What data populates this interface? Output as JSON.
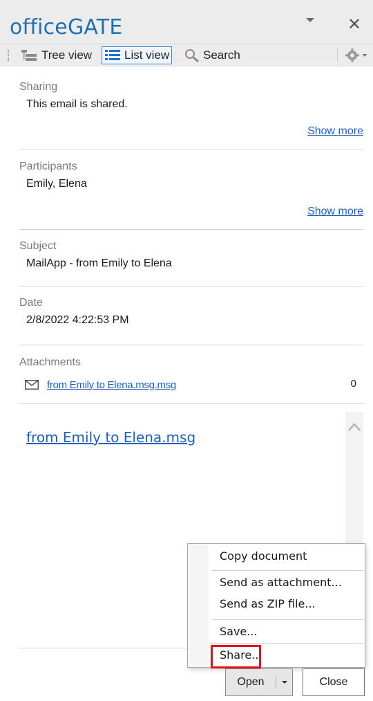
{
  "app": {
    "title": "officeGATE"
  },
  "toolbar": {
    "tree_view": "Tree view",
    "list_view": "List view",
    "search": "Search"
  },
  "sections": {
    "sharing": {
      "label": "Sharing",
      "value": "This email is shared.",
      "more": "Show more"
    },
    "participants": {
      "label": "Participants",
      "value": "Emily, Elena",
      "more": "Show more"
    },
    "subject": {
      "label": "Subject",
      "value": "MailApp - from Emily to Elena"
    },
    "date": {
      "label": "Date",
      "value": "2/8/2022 4:22:53 PM"
    },
    "attachments": {
      "label": "Attachments",
      "items": [
        {
          "name": "from Emily to Elena.msg.msg",
          "count": "0"
        }
      ]
    }
  },
  "preview": {
    "title": "from Emily to Elena.msg"
  },
  "context_menu": {
    "items": [
      "Copy document",
      "Send as attachment...",
      "Send as ZIP file...",
      "Save...",
      "Share.."
    ]
  },
  "buttons": {
    "open": "Open",
    "close": "Close"
  },
  "colors": {
    "accent": "#1f6fb2",
    "link": "#1a5fc7",
    "highlight": "#e1141e"
  }
}
